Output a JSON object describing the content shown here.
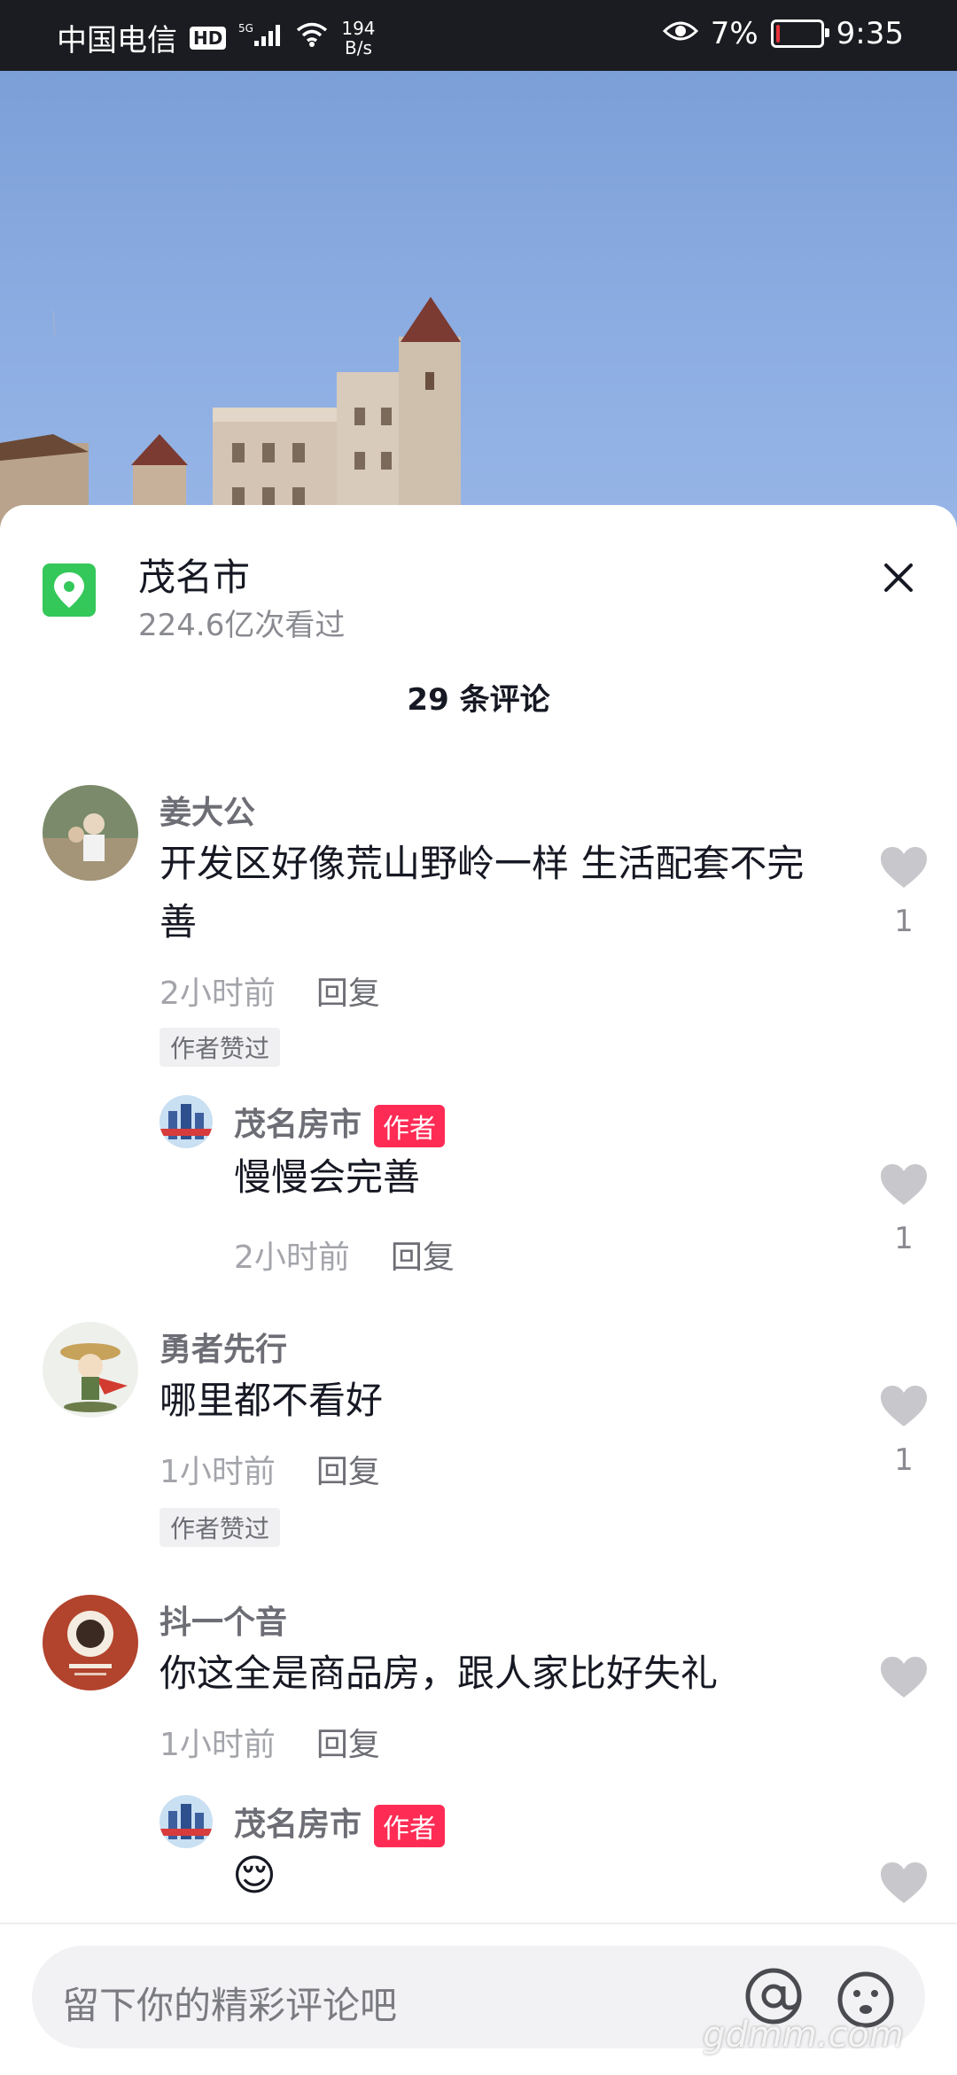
{
  "status_bar": {
    "carrier": "中国电信",
    "hd": "HD",
    "network": "5G",
    "speed_value": "194",
    "speed_unit": "B/s",
    "battery": "7%",
    "battery_level": 0.07,
    "time": "9:35"
  },
  "location": {
    "title": "茂名市",
    "views": "224.6亿次看过"
  },
  "comment_count": "29 条评论",
  "comments": [
    {
      "user": "姜大公",
      "text": "开发区好像荒山野岭一样 生活配套不完善",
      "time": "2小时前",
      "reply": "回复",
      "liked_label": "作者赞过",
      "likes": "1"
    },
    {
      "user": "茂名房市",
      "badge": "作者",
      "text": "慢慢会完善",
      "time": "2小时前",
      "reply": "回复",
      "likes": "1"
    },
    {
      "user": "勇者先行",
      "text": "哪里都不看好",
      "time": "1小时前",
      "reply": "回复",
      "liked_label": "作者赞过",
      "likes": "1"
    },
    {
      "user": "抖一个音",
      "text": "你这全是商品房，跟人家比好失礼",
      "time": "1小时前",
      "reply": "回复"
    },
    {
      "user": "茂名房市",
      "badge": "作者",
      "emoji": "😌"
    }
  ],
  "input": {
    "placeholder": "留下你的精彩评论吧"
  },
  "watermark": "gdmm.com",
  "colors": {
    "accent_red": "#fe2c55",
    "location_green": "#34c759"
  }
}
